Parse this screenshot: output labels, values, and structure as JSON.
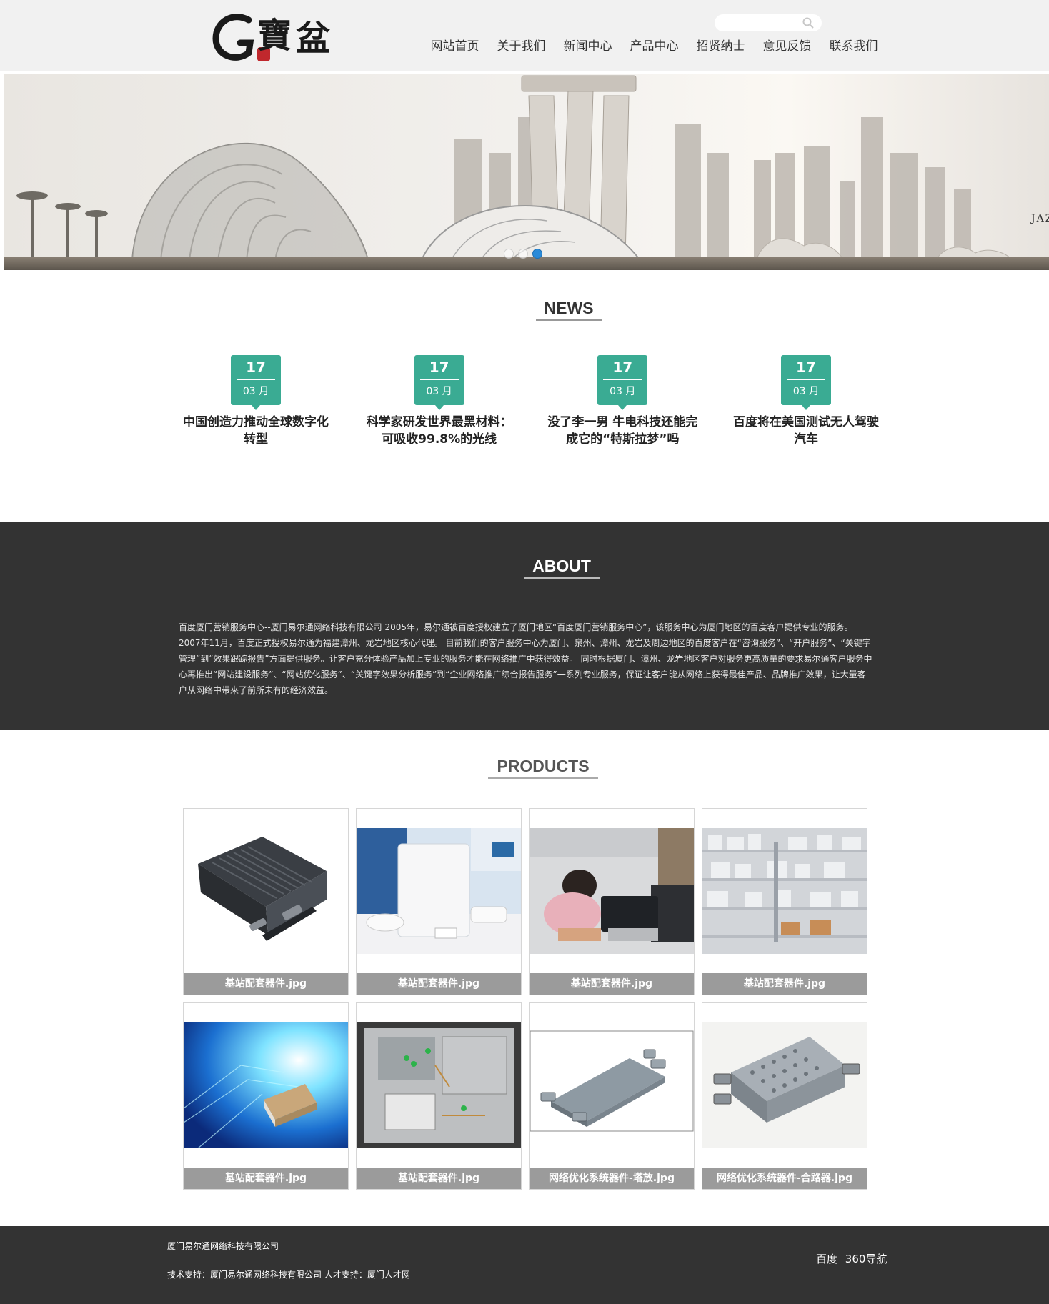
{
  "header": {
    "logo_alt": "G 寶盆",
    "search_placeholder": "",
    "nav": [
      "网站首页",
      "关于我们",
      "新闻中心",
      "产品中心",
      "招贤纳士",
      "意见反馈",
      "联系我们"
    ]
  },
  "banner": {
    "watermark": "JAZ",
    "slides_count": 3,
    "active_slide": 3
  },
  "news": {
    "title": "NEWS",
    "items": [
      {
        "day": "17",
        "month": "03 月",
        "title": "中国创造力推动全球数字化转型"
      },
      {
        "day": "17",
        "month": "03 月",
        "title": "科学家研发世界最黑材料：可吸收99.8%的光线"
      },
      {
        "day": "17",
        "month": "03 月",
        "title": "没了李一男 牛电科技还能完成它的“特斯拉梦”吗"
      },
      {
        "day": "17",
        "month": "03 月",
        "title": "百度将在美国测试无人驾驶汽车"
      }
    ]
  },
  "about": {
    "title": "ABOUT",
    "text": "百度厦门营销服务中心--厦门易尔通网络科技有限公司 2005年，易尔通被百度授权建立了厦门地区“百度厦门营销服务中心”，该服务中心为厦门地区的百度客户提供专业的服务。2007年11月，百度正式授权易尔通为福建漳州、龙岩地区核心代理。 目前我们的客户服务中心为厦门、泉州、漳州、龙岩及周边地区的百度客户在“咨询服务”、“开户服务”、“关键字管理”到“效果跟踪报告”方面提供服务。让客户充分体验产品加上专业的服务才能在网络推广中获得效益。 同时根据厦门、漳州、龙岩地区客户对服务更高质量的要求易尔通客户服务中心再推出“网站建设服务”、“网站优化服务”、“关键字效果分析服务”到“企业网络推广综合报告服务”一系列专业服务，保证让客户能从网络上获得最佳产品、品牌推广效果，让大量客户从网络中带来了前所未有的经济效益。"
  },
  "products": {
    "title": "PRODUCTS",
    "items": [
      {
        "caption": "基站配套器件.jpg",
        "image": "black-metal-enclosure"
      },
      {
        "caption": "基站配套器件.jpg",
        "image": "white-antenna-panel"
      },
      {
        "caption": "基站配套器件.jpg",
        "image": "technician-testing"
      },
      {
        "caption": "基站配套器件.jpg",
        "image": "component-shelves"
      },
      {
        "caption": "基站配套器件.jpg",
        "image": "capacitor-blue-background"
      },
      {
        "caption": "基站配套器件.jpg",
        "image": "open-circuit-cabinet"
      },
      {
        "caption": "网络优化系统器件-塔放.jpg",
        "image": "tower-amplifier"
      },
      {
        "caption": "网络优化系统器件-合路器.jpg",
        "image": "combiner-device"
      }
    ]
  },
  "footer": {
    "company": "厦门易尔通网络科技有限公司",
    "support": "技术支持：厦门易尔通网络科技有限公司 人才支持：厦门人才网",
    "links": [
      "百度",
      "360导航"
    ]
  }
}
